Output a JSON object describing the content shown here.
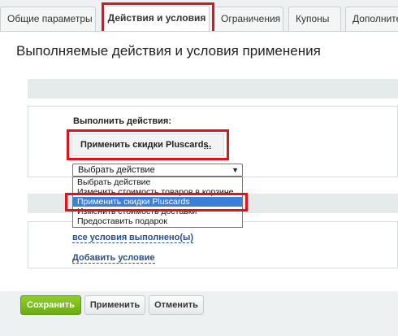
{
  "tabs": [
    {
      "label": "Общие параметры"
    },
    {
      "label": "Действия и условия"
    },
    {
      "label": "Ограничения"
    },
    {
      "label": "Купоны"
    },
    {
      "label": "Дополните"
    }
  ],
  "page_title": "Выполняемые действия и условия применения",
  "actions": {
    "heading": "Выполнить действия:",
    "chip_label": "Применить скидки Pluscards",
    "chip_more": "...",
    "select_value": "Выбрать действие",
    "options": [
      "Выбрать действие",
      "Изменить стоимость товаров в корзине",
      "Применить скидки Pluscards",
      "Изменить стоимость доставки",
      "Предоставить подарок"
    ]
  },
  "conditions": {
    "link_all": "все условия",
    "link_done": "выполнено(ы)",
    "add_condition": "Добавить условие"
  },
  "buttons": {
    "save": "Сохранить",
    "apply": "Применить",
    "cancel": "Отменить"
  },
  "colors": {
    "highlight": "#e0131c",
    "selected_option": "#3b7fd9",
    "save_button": "#7bbd1e",
    "link": "#2b4f8a"
  }
}
